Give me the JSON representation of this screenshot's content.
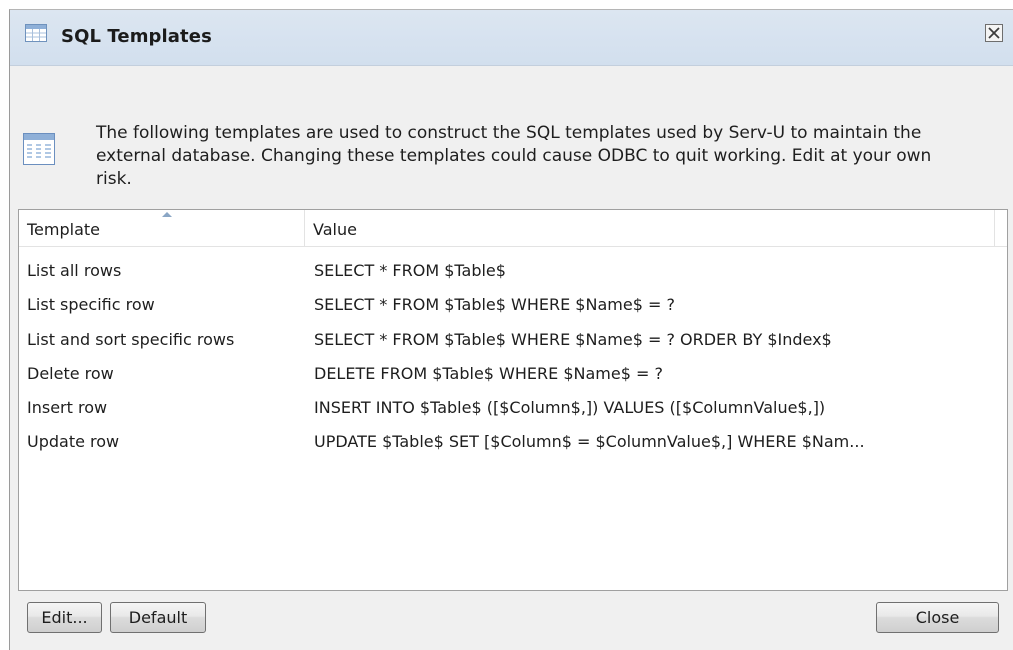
{
  "window": {
    "title": "SQL Templates",
    "title_icon": "table-grid-icon",
    "close_icon": "close-x-icon"
  },
  "message": {
    "icon": "table-list-icon",
    "text": "The following templates are used to construct the SQL templates used by Serv-U to maintain the external database. Changing these templates could cause ODBC to quit working. Edit at your own risk."
  },
  "list": {
    "columns": [
      "Template",
      "Value"
    ],
    "sorted_column": "Template",
    "rows": [
      {
        "template": "List all rows",
        "value": "SELECT * FROM $Table$"
      },
      {
        "template": "List specific row",
        "value": "SELECT * FROM $Table$ WHERE $Name$ = ?"
      },
      {
        "template": "List and sort specific rows",
        "value": "SELECT * FROM $Table$ WHERE $Name$ = ? ORDER BY $Index$"
      },
      {
        "template": "Delete row",
        "value": "DELETE FROM $Table$ WHERE $Name$ = ?"
      },
      {
        "template": "Insert row",
        "value": "INSERT INTO $Table$ ([$Column$,]) VALUES ([$ColumnValue$,])"
      },
      {
        "template": "Update row",
        "value": "UPDATE $Table$ SET [$Column$ = $ColumnValue$,] WHERE $Nam..."
      }
    ]
  },
  "buttons": {
    "edit": "Edit...",
    "default": "Default",
    "close": "Close"
  },
  "colors": {
    "titlebar": "#d6e2ef",
    "dialog_bg": "#f0f0f0",
    "list_bg": "#ffffff"
  }
}
